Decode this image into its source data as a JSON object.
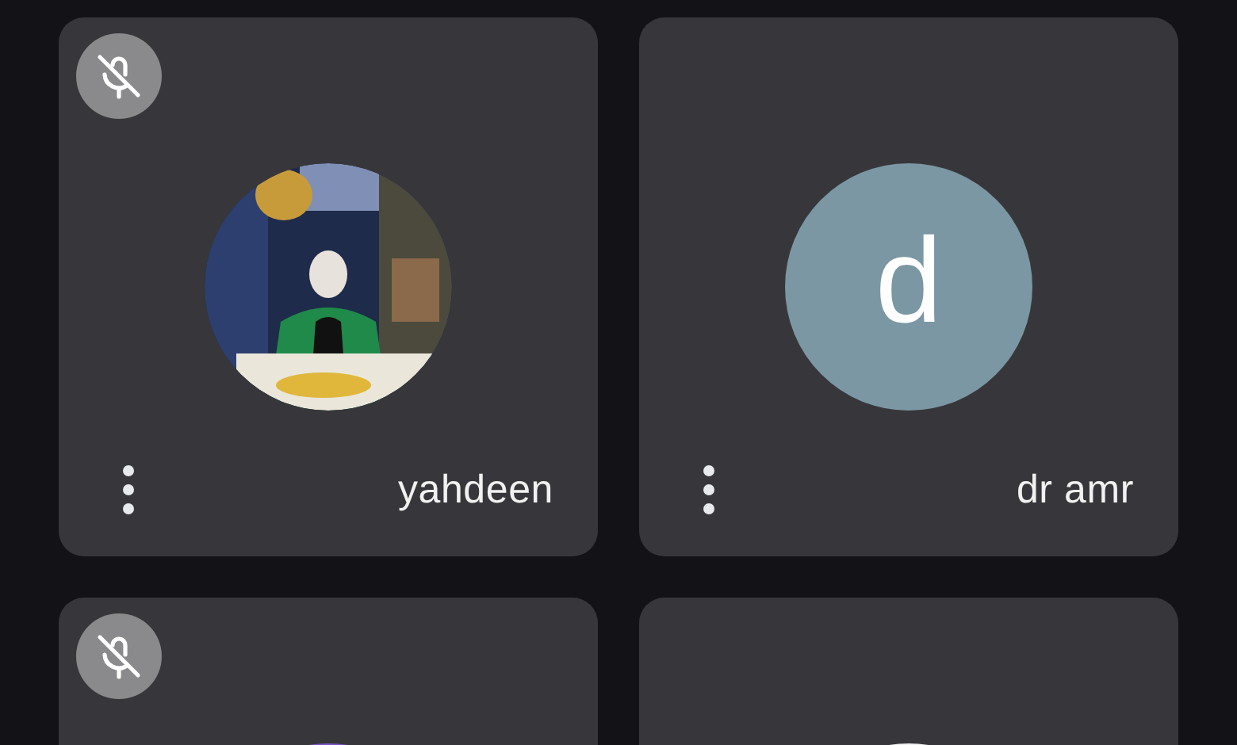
{
  "tiles": [
    {
      "name": "yahdeen",
      "muted": true,
      "menu": true
    },
    {
      "name": "dr amr",
      "muted": false,
      "avatar": {
        "kind": "letter",
        "letter": "d",
        "color": "#7b97a3"
      },
      "menu": true
    },
    {
      "muted": true,
      "avatar": {
        "kind": "circle",
        "color": "#7d55c7"
      },
      "menu": false
    },
    {
      "muted": false,
      "avatar": {
        "kind": "circle",
        "color": "#f1f1f1"
      },
      "menu": false
    }
  ]
}
